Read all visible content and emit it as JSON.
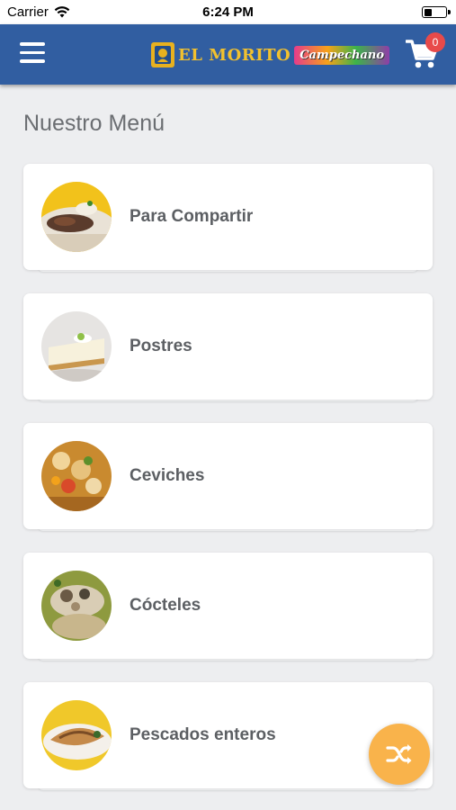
{
  "status_bar": {
    "carrier": "Carrier",
    "time": "6:24 PM"
  },
  "navbar": {
    "logo_text": "EL MORITO",
    "logo_sub": "Campechano",
    "cart_count": "0"
  },
  "page_title": "Nuestro Menú",
  "categories": [
    {
      "label": "Para Compartir",
      "thumb": "platter-thumbnail"
    },
    {
      "label": "Postres",
      "thumb": "pie-slice-thumbnail"
    },
    {
      "label": "Ceviches",
      "thumb": "ceviche-thumbnail"
    },
    {
      "label": "Cócteles",
      "thumb": "cocktail-thumbnail"
    },
    {
      "label": "Pescados enteros",
      "thumb": "fish-thumbnail"
    }
  ],
  "colors": {
    "navbar": "#315ea1",
    "background": "#edeef0",
    "fab": "#f9b34b",
    "badge": "#e84a4a",
    "text": "#5c5f63"
  },
  "icons": {
    "menu": "hamburger-icon",
    "cart": "cart-icon",
    "fab": "shuffle-icon"
  }
}
